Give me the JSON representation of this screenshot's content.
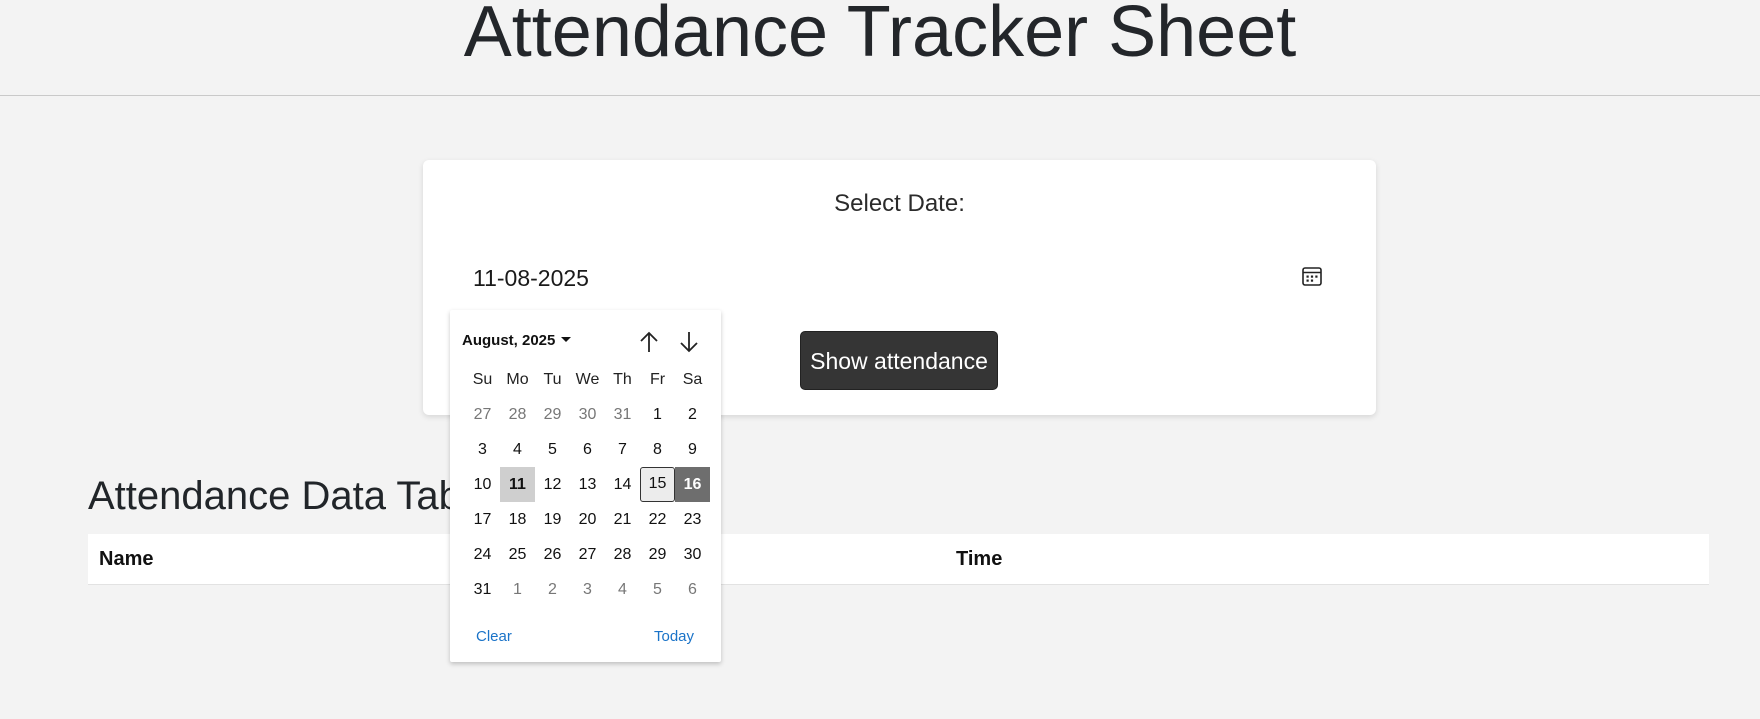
{
  "header": {
    "title": "Attendance Tracker Sheet"
  },
  "form": {
    "label": "Select Date:",
    "date_value": "11-08-2025",
    "calendar_icon": "calendar-icon",
    "button_label": "Show attendance"
  },
  "table": {
    "title": "Attendance Data Tab",
    "columns": [
      "Name",
      "Time"
    ]
  },
  "picker": {
    "month_label": "August, 2025",
    "weekdays": [
      "Su",
      "Mo",
      "Tu",
      "We",
      "Th",
      "Fr",
      "Sa"
    ],
    "weeks": [
      [
        {
          "d": "27",
          "m": true
        },
        {
          "d": "28",
          "m": true
        },
        {
          "d": "29",
          "m": true
        },
        {
          "d": "30",
          "m": true
        },
        {
          "d": "31",
          "m": true
        },
        {
          "d": "1"
        },
        {
          "d": "2"
        }
      ],
      [
        {
          "d": "3"
        },
        {
          "d": "4"
        },
        {
          "d": "5"
        },
        {
          "d": "6"
        },
        {
          "d": "7"
        },
        {
          "d": "8"
        },
        {
          "d": "9"
        }
      ],
      [
        {
          "d": "10"
        },
        {
          "d": "11",
          "s": "sel"
        },
        {
          "d": "12"
        },
        {
          "d": "13"
        },
        {
          "d": "14"
        },
        {
          "d": "15",
          "s": "hover"
        },
        {
          "d": "16",
          "s": "today"
        }
      ],
      [
        {
          "d": "17"
        },
        {
          "d": "18"
        },
        {
          "d": "19"
        },
        {
          "d": "20"
        },
        {
          "d": "21"
        },
        {
          "d": "22"
        },
        {
          "d": "23"
        }
      ],
      [
        {
          "d": "24"
        },
        {
          "d": "25"
        },
        {
          "d": "26"
        },
        {
          "d": "27"
        },
        {
          "d": "28"
        },
        {
          "d": "29"
        },
        {
          "d": "30"
        }
      ],
      [
        {
          "d": "31"
        },
        {
          "d": "1",
          "m": true
        },
        {
          "d": "2",
          "m": true
        },
        {
          "d": "3",
          "m": true
        },
        {
          "d": "4",
          "m": true
        },
        {
          "d": "5",
          "m": true
        },
        {
          "d": "6",
          "m": true
        }
      ]
    ],
    "clear_label": "Clear",
    "today_label": "Today"
  }
}
